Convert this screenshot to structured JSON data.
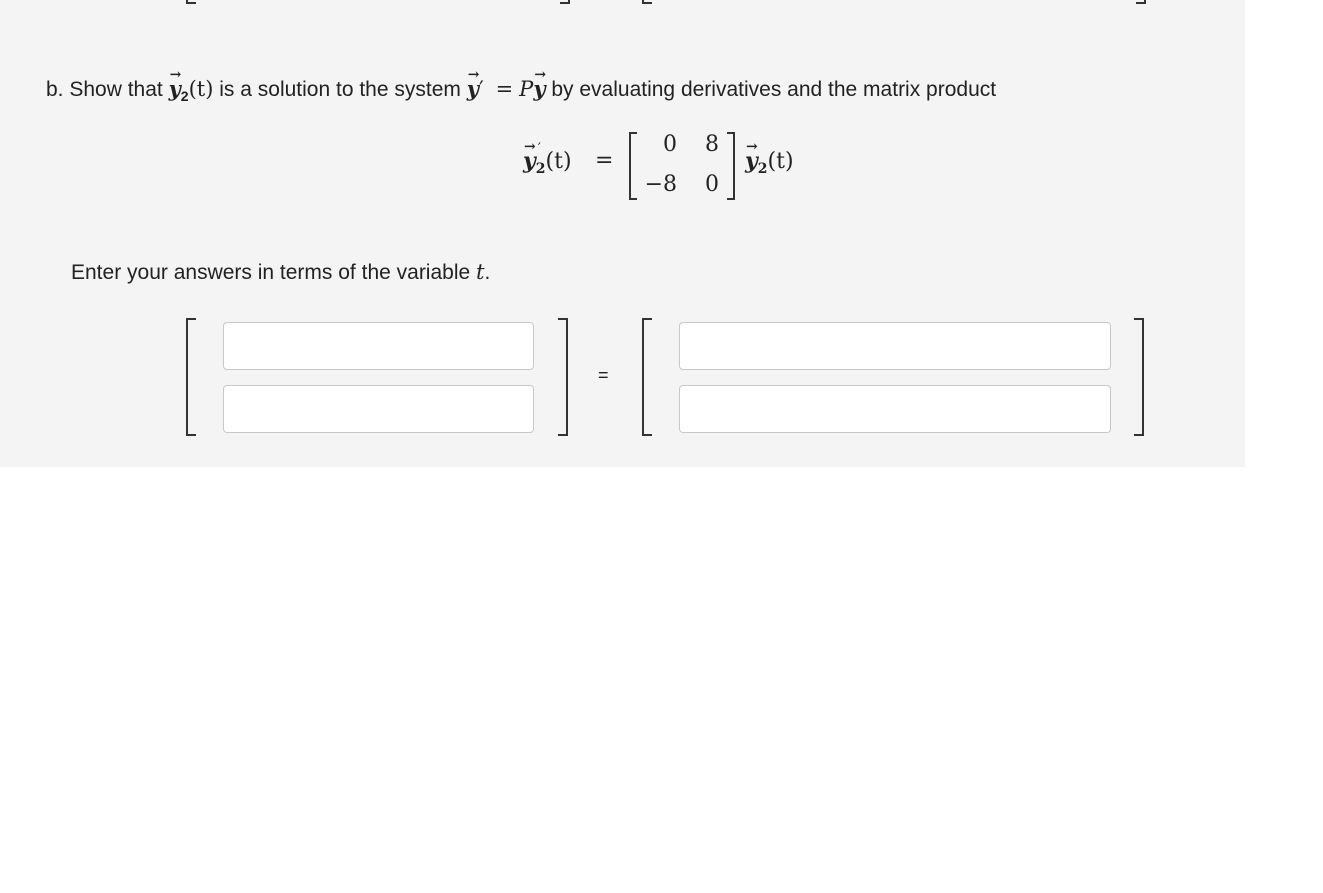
{
  "question": {
    "prefix": "b. Show that",
    "y_symbol": "y",
    "subscript": "2",
    "arg": "(t)",
    "middle": "is a solution to the system",
    "prime": "′",
    "equals": "=",
    "P": "P",
    "suffix": "by evaluating derivatives and the matrix product"
  },
  "equation": {
    "lhs_y": "y",
    "lhs_sub": "2",
    "lhs_prime": "′",
    "lhs_arg": "(t)",
    "equals": "=",
    "matrix": {
      "a11": "0",
      "a12": "8",
      "a21": "−8",
      "a22": "0"
    },
    "rhs_y": "y",
    "rhs_sub": "2",
    "rhs_arg": "(t)"
  },
  "instruction": {
    "text": "Enter your answers in terms of the variable",
    "variable": "t",
    "period": "."
  },
  "answer": {
    "equals": "=",
    "left_top_value": "",
    "left_bottom_value": "",
    "right_top_value": "",
    "right_bottom_value": ""
  }
}
